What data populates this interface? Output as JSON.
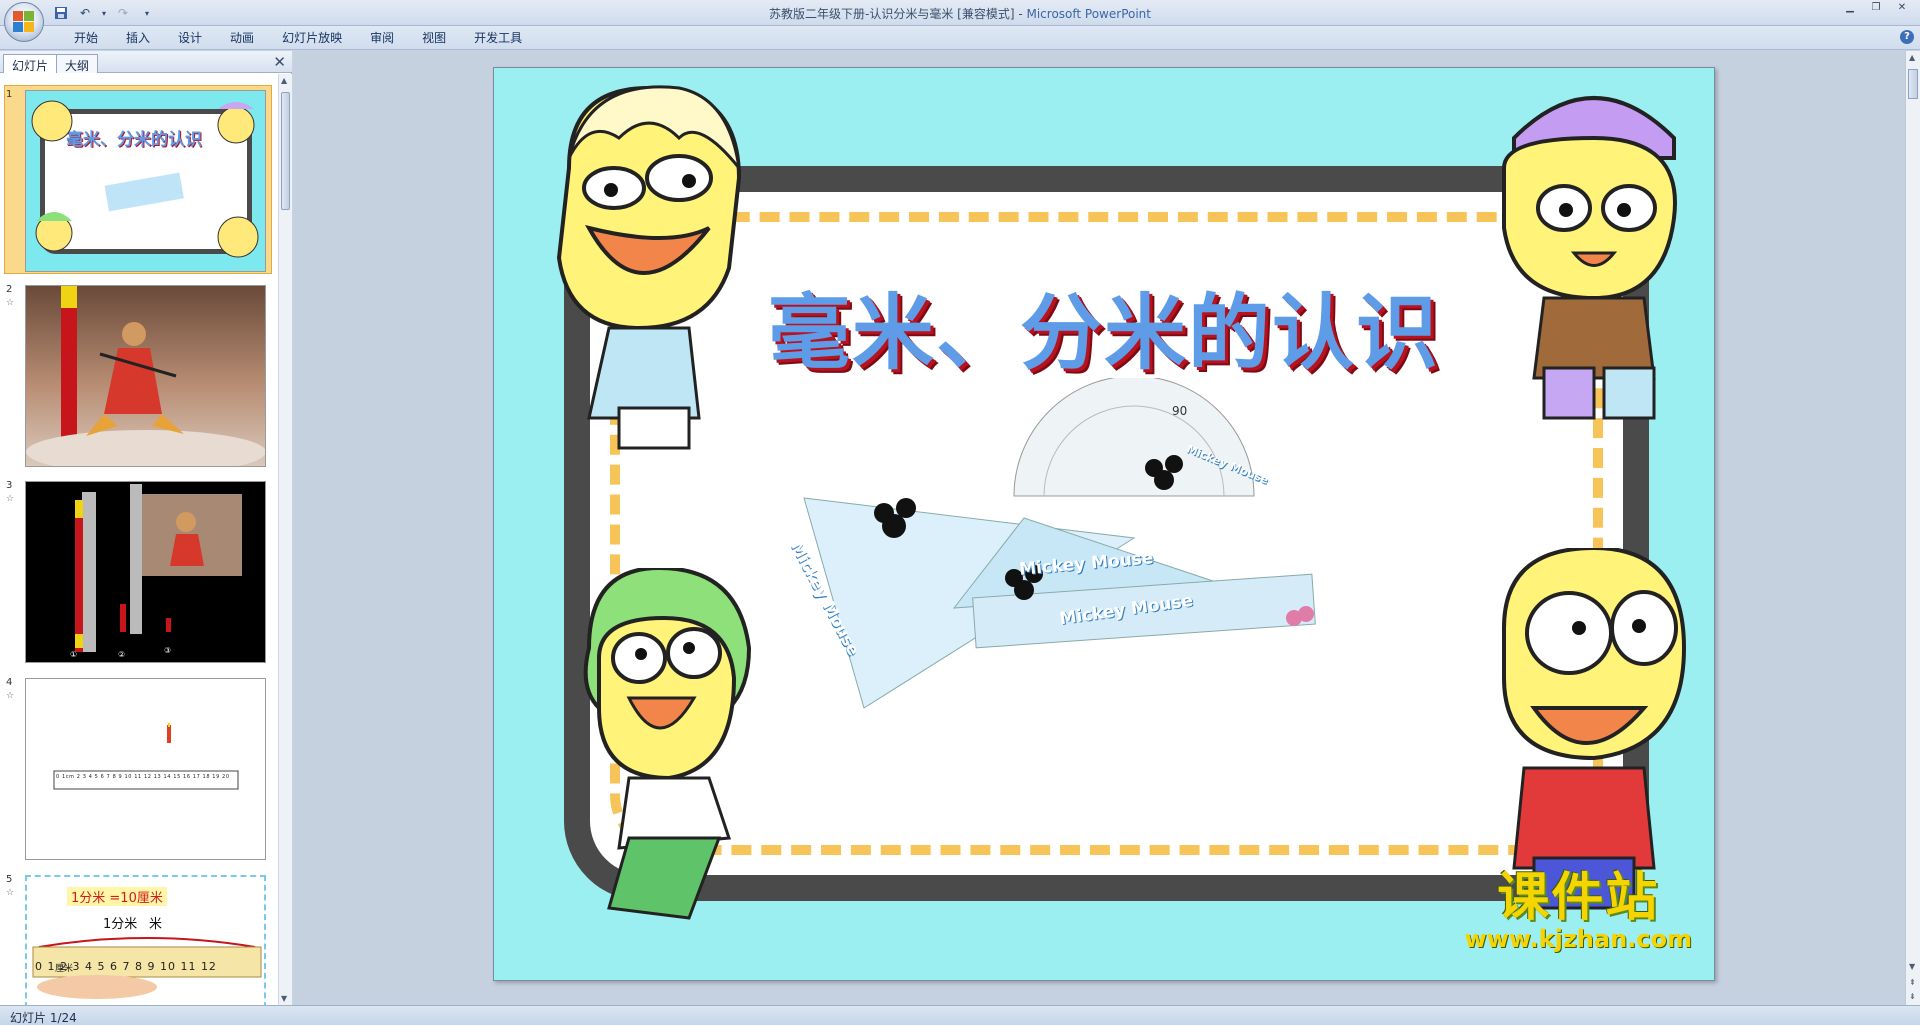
{
  "window": {
    "title_doc": "苏教版二年级下册-认识分米与毫米 [兼容模式] - ",
    "title_app": "Microsoft PowerPoint"
  },
  "ribbon": {
    "tabs": [
      "开始",
      "插入",
      "设计",
      "动画",
      "幻灯片放映",
      "审阅",
      "视图",
      "开发工具"
    ]
  },
  "left_pane": {
    "tab_slides": "幻灯片",
    "tab_outline": "大纲",
    "thumbnails": [
      {
        "num": "1",
        "title": "毫米、分米的认识"
      },
      {
        "num": "2"
      },
      {
        "num": "3",
        "labels": [
          "①",
          "②",
          "③"
        ]
      },
      {
        "num": "4",
        "ruler_labels": "0 1cm 2 3 4 5 6 7 8 9 10 11 12 13 14 15 16 17 18 19 20"
      },
      {
        "num": "5",
        "line1": "1分米 =10厘米",
        "line2": "1分米",
        "ruler_nums": "0 1 2 3 4 5 6 7 8 9 10 11 12",
        "unit": "厘米",
        "bracket_label": "米"
      }
    ]
  },
  "slide": {
    "title": "毫米、分米的认识",
    "rulers": [
      "Mickey Mouse",
      "Mickey Mouse",
      "Mickey Mouse",
      "Mickey Mouse"
    ],
    "protractor_mark": "90"
  },
  "watermark": {
    "cn": "课件站",
    "url": "www.kjzhan.com"
  },
  "status": {
    "slide_info": "幻灯片 1/24"
  }
}
